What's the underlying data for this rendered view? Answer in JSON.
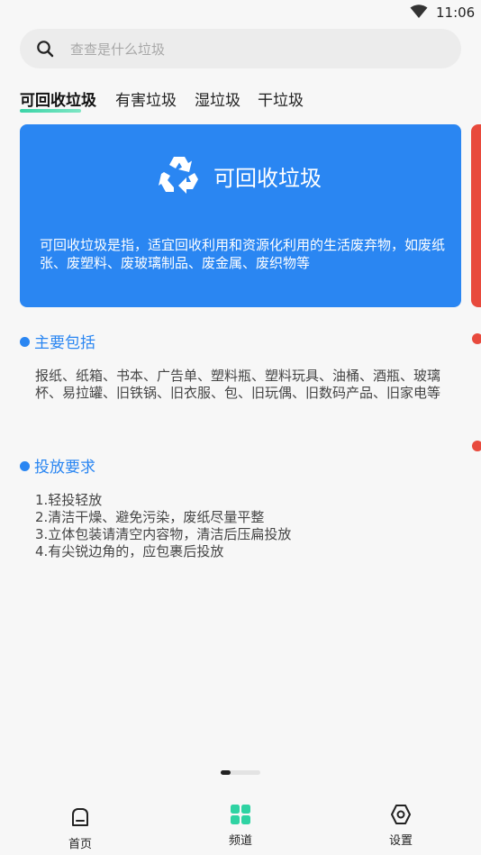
{
  "status_bar": {
    "time": "11:06",
    "icons": [
      "wifi-icon"
    ]
  },
  "search": {
    "placeholder": "查查是什么垃圾",
    "icon": "search-icon"
  },
  "tabs": [
    {
      "label": "可回收垃圾",
      "active": true
    },
    {
      "label": "有害垃圾",
      "active": false
    },
    {
      "label": "湿垃圾",
      "active": false
    },
    {
      "label": "干垃圾",
      "active": false
    }
  ],
  "card": {
    "title": "可回收垃圾",
    "icon": "recycle-icon",
    "description": "可回收垃圾是指，适宜回收利用和资源化利用的生活废弃物，如废纸张、废塑料、废玻璃制品、废金属、废织物等",
    "color": "#2a86f2"
  },
  "next_card_color": "#e84a3d",
  "sections": {
    "includes": {
      "title": "主要包括",
      "body": "报纸、纸箱、书本、广告单、塑料瓶、塑料玩具、油桶、酒瓶、玻璃杯、易拉罐、旧铁锅、旧衣服、包、旧玩偶、旧数码产品、旧家电等"
    },
    "requirements": {
      "title": "投放要求",
      "items": [
        "1.轻投轻放",
        "2.清洁干燥、避免污染，废纸尽量平整",
        "3.立体包装请清空内容物，清洁后压扁投放",
        "4.有尖锐边角的，应包裹后投放"
      ]
    }
  },
  "page_indicator": {
    "current": 1,
    "total": 4
  },
  "bottom_nav": [
    {
      "label": "首页",
      "icon": "home-icon",
      "active": false
    },
    {
      "label": "频道",
      "icon": "grid-icon",
      "active": true
    },
    {
      "label": "设置",
      "icon": "settings-icon",
      "active": false
    }
  ],
  "colors": {
    "accent": "#2a86f2",
    "tab_indicator": "#3bd4a7",
    "nav_active": "#2fd3a3"
  }
}
